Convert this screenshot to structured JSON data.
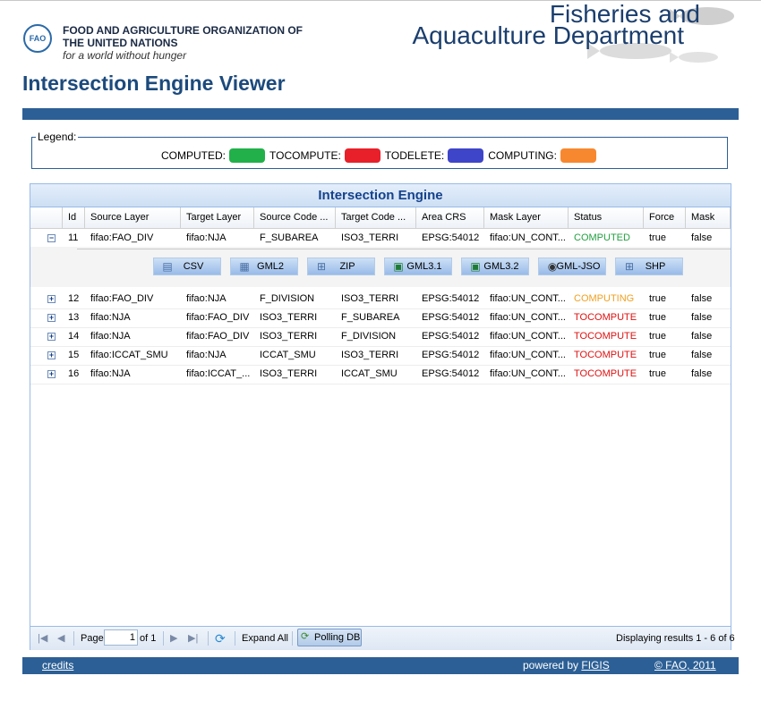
{
  "header": {
    "org_line1": "FOOD AND AGRICULTURE ORGANIZATION OF",
    "org_line2": "THE UNITED NATIONS",
    "tagline": "for a world without hunger",
    "logo_text": "FAO",
    "dept_line1": "Fisheries and",
    "dept_line2": "Aquaculture Department"
  },
  "page_title": "Intersection Engine Viewer",
  "legend": {
    "title": "Legend:",
    "items": [
      {
        "label": "COMPUTED:",
        "color": "#22b04a"
      },
      {
        "label": "TOCOMPUTE:",
        "color": "#e8202a"
      },
      {
        "label": "TODELETE:",
        "color": "#3f45c8"
      },
      {
        "label": "COMPUTING:",
        "color": "#f7882f"
      }
    ]
  },
  "grid": {
    "title": "Intersection Engine",
    "columns": [
      "Id",
      "Source Layer",
      "Target Layer",
      "Source Code ...",
      "Target Code ...",
      "Area CRS",
      "Mask Layer",
      "Status",
      "Force",
      "Mask"
    ],
    "rows": [
      {
        "id": "11",
        "source": "fifao:FAO_DIV",
        "target": "fifao:NJA",
        "scode": "F_SUBAREA",
        "tcode": "ISO3_TERRI",
        "crs": "EPSG:54012",
        "mask_layer": "fifao:UN_CONT...",
        "status": "COMPUTED",
        "force": "true",
        "mask": "false",
        "expanded": true
      },
      {
        "id": "12",
        "source": "fifao:FAO_DIV",
        "target": "fifao:NJA",
        "scode": "F_DIVISION",
        "tcode": "ISO3_TERRI",
        "crs": "EPSG:54012",
        "mask_layer": "fifao:UN_CONT...",
        "status": "COMPUTING",
        "force": "true",
        "mask": "false",
        "expanded": false
      },
      {
        "id": "13",
        "source": "fifao:NJA",
        "target": "fifao:FAO_DIV",
        "scode": "ISO3_TERRI",
        "tcode": "F_SUBAREA",
        "crs": "EPSG:54012",
        "mask_layer": "fifao:UN_CONT...",
        "status": "TOCOMPUTE",
        "force": "true",
        "mask": "false",
        "expanded": false
      },
      {
        "id": "14",
        "source": "fifao:NJA",
        "target": "fifao:FAO_DIV",
        "scode": "ISO3_TERRI",
        "tcode": "F_DIVISION",
        "crs": "EPSG:54012",
        "mask_layer": "fifao:UN_CONT...",
        "status": "TOCOMPUTE",
        "force": "true",
        "mask": "false",
        "expanded": false
      },
      {
        "id": "15",
        "source": "fifao:ICCAT_SMU",
        "target": "fifao:NJA",
        "scode": "ICCAT_SMU",
        "tcode": "ISO3_TERRI",
        "crs": "EPSG:54012",
        "mask_layer": "fifao:UN_CONT...",
        "status": "TOCOMPUTE",
        "force": "true",
        "mask": "false",
        "expanded": false
      },
      {
        "id": "16",
        "source": "fifao:NJA",
        "target": "fifao:ICCAT_...",
        "scode": "ISO3_TERRI",
        "tcode": "ICCAT_SMU",
        "crs": "EPSG:54012",
        "mask_layer": "fifao:UN_CONT...",
        "status": "TOCOMPUTE",
        "force": "true",
        "mask": "false",
        "expanded": false
      }
    ],
    "status_colors": {
      "COMPUTED": "#22a040",
      "COMPUTING": "#f0a020",
      "TOCOMPUTE": "#e01010",
      "TODELETE": "#3f45c8"
    },
    "downloads": [
      {
        "label": "CSV",
        "icon": "csv-icon"
      },
      {
        "label": "GML2",
        "icon": "xml-icon"
      },
      {
        "label": "ZIP",
        "icon": "network-icon"
      },
      {
        "label": "GML3.1",
        "icon": "excel-icon"
      },
      {
        "label": "GML3.2",
        "icon": "excel-icon"
      },
      {
        "label": "GML-JSO",
        "icon": "globe-icon"
      },
      {
        "label": "SHP",
        "icon": "network-icon"
      }
    ]
  },
  "toolbar": {
    "page_label": "Page",
    "page_value": "1",
    "of_label": "of 1",
    "expand_all": "Expand All",
    "polling": "Polling DB",
    "displaying": "Displaying results 1 - 6 of 6"
  },
  "footer": {
    "credits": "credits",
    "powered_by": "powered by ",
    "figis": "FIGIS",
    "copyright": "© FAO, 2011"
  }
}
